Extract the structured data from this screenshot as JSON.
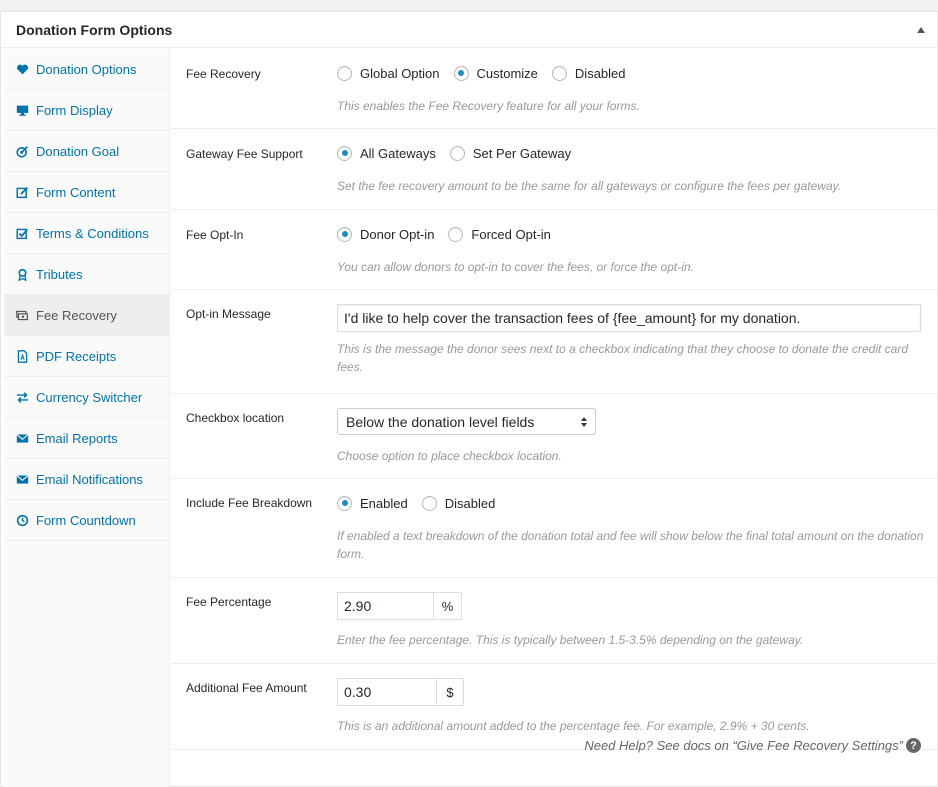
{
  "panel": {
    "title": "Donation Form Options"
  },
  "sidebar": {
    "items": [
      {
        "label": "Donation Options",
        "icon": "heart-icon"
      },
      {
        "label": "Form Display",
        "icon": "monitor-icon"
      },
      {
        "label": "Donation Goal",
        "icon": "target-icon"
      },
      {
        "label": "Form Content",
        "icon": "edit-icon"
      },
      {
        "label": "Terms & Conditions",
        "icon": "checkbox-icon"
      },
      {
        "label": "Tributes",
        "icon": "award-icon"
      },
      {
        "label": "Fee Recovery",
        "icon": "money-icon"
      },
      {
        "label": "PDF Receipts",
        "icon": "pdf-icon"
      },
      {
        "label": "Currency Switcher",
        "icon": "switch-arrows-icon"
      },
      {
        "label": "Email Reports",
        "icon": "email-icon"
      },
      {
        "label": "Email Notifications",
        "icon": "email-icon"
      },
      {
        "label": "Form Countdown",
        "icon": "clock-icon"
      }
    ],
    "active": "Fee Recovery"
  },
  "fields": {
    "fee_recovery": {
      "label": "Fee Recovery",
      "options": [
        "Global Option",
        "Customize",
        "Disabled"
      ],
      "selected": "Customize",
      "desc": "This enables the Fee Recovery feature for all your forms."
    },
    "gateway_support": {
      "label": "Gateway Fee Support",
      "options": [
        "All Gateways",
        "Set Per Gateway"
      ],
      "selected": "All Gateways",
      "desc": "Set the fee recovery amount to be the same for all gateways or configure the fees per gateway."
    },
    "opt_in": {
      "label": "Fee Opt-In",
      "options": [
        "Donor Opt-in",
        "Forced Opt-in"
      ],
      "selected": "Donor Opt-in",
      "desc": "You can allow donors to opt-in to cover the fees, or force the opt-in."
    },
    "opt_in_message": {
      "label": "Opt-in Message",
      "value": "I'd like to help cover the transaction fees of {fee_amount} for my donation.",
      "desc": "This is the message the donor sees next to a checkbox indicating that they choose to donate the credit card fees."
    },
    "checkbox_location": {
      "label": "Checkbox location",
      "selected": "Below the donation level fields",
      "desc": "Choose option to place checkbox location."
    },
    "fee_breakdown": {
      "label": "Include Fee Breakdown",
      "options": [
        "Enabled",
        "Disabled"
      ],
      "selected": "Enabled",
      "desc": "If enabled a text breakdown of the donation total and fee will show below the final total amount on the donation form."
    },
    "fee_percentage": {
      "label": "Fee Percentage",
      "value": "2.90",
      "addon": "%",
      "desc": "Enter the fee percentage. This is typically between 1.5-3.5% depending on the gateway."
    },
    "additional_fee": {
      "label": "Additional Fee Amount",
      "value": "0.30",
      "addon": "$",
      "desc": "This is an additional amount added to the percentage fee. For example, 2.9% + 30 cents."
    }
  },
  "help": {
    "text": "Need Help? See docs on “Give Fee Recovery Settings”",
    "icon_char": "?"
  },
  "colors": {
    "link": "#0073aa",
    "radio_dot": "#1e8cbe",
    "desc": "#999999"
  }
}
